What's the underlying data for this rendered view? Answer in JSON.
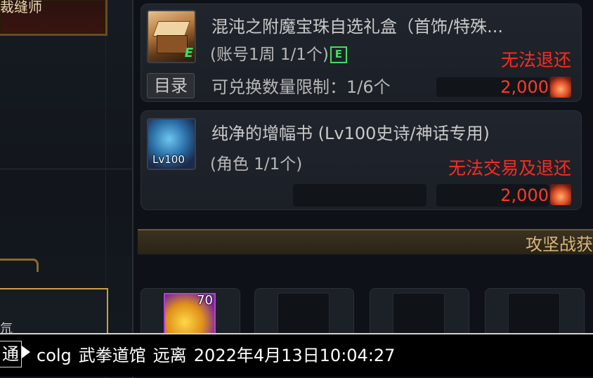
{
  "left_panel": {
    "header_text": "裁缝师",
    "slot_char": "氘"
  },
  "items": [
    {
      "name": "混沌之附魔宝珠自选礼盒（首饰/特殊...",
      "sub": "(账号1周 1/1个)",
      "grade_tag": "E",
      "restriction": "无法退还",
      "limit": "可兑换数量限制：1/6个",
      "price": "2,000",
      "catalog": "目录",
      "icon": "gift-box-icon"
    },
    {
      "name": "纯净的增幅书 (Lv100史诗/神话专用)",
      "sub": "(角色 1/1个)",
      "restriction": "无法交易及退还",
      "level_badge": "Lv100",
      "price": "2,000",
      "icon": "amplification-book-icon"
    }
  ],
  "section": {
    "title": "攻坚战获"
  },
  "bottom_slots": [
    {
      "count": "70",
      "icon": "orb-icon"
    },
    {},
    {},
    {}
  ],
  "chat": {
    "channel": "通",
    "sender": "colg",
    "location": "武拳道馆",
    "status": "远离",
    "timestamp": "2022年4月13日10:04:27"
  },
  "colors": {
    "warning": "#ff2a1e",
    "price": "#ff3a2a",
    "grade_e": "#40e060",
    "section_title": "#d9b678"
  }
}
